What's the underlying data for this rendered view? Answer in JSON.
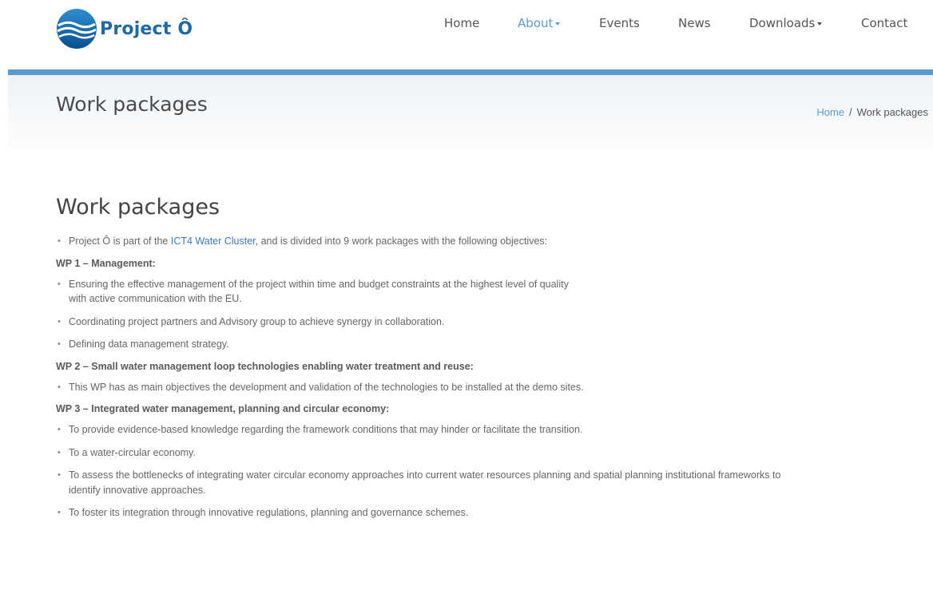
{
  "header": {
    "logo_text": "Project Ô",
    "nav": [
      {
        "label": "Home",
        "has_caret": false,
        "active": false
      },
      {
        "label": "About",
        "has_caret": true,
        "active": true
      },
      {
        "label": "Events",
        "has_caret": false,
        "active": false
      },
      {
        "label": "News",
        "has_caret": false,
        "active": false
      },
      {
        "label": "Downloads",
        "has_caret": true,
        "active": false
      },
      {
        "label": "Contact",
        "has_caret": false,
        "active": false
      }
    ]
  },
  "banner": {
    "title": "Work packages",
    "breadcrumb": {
      "home": "Home",
      "separator": "/",
      "current": "Work packages"
    }
  },
  "content": {
    "title": "Work packages",
    "intro": {
      "before": "Project Ô is part of the ",
      "link": "ICT4 Water Cluster",
      "after": ", and is divided into 9 work packages with the following objectives:"
    },
    "wp1": {
      "heading": "WP 1 – Management:",
      "items": [
        "Ensuring the effective management of the project within time and budget constraints at the highest level of quality",
        "with active communication with the EU.",
        "Coordinating project partners and Advisory group to achieve synergy in collaboration.",
        "Defining data management strategy."
      ]
    },
    "wp2": {
      "heading": "WP 2 – Small water management loop technologies enabling water treatment and reuse:",
      "items": [
        "This WP has as main objectives the development and validation of the technologies to be installed at the demo sites."
      ]
    },
    "wp3": {
      "heading": "WP 3 – Integrated water management, planning and circular economy:",
      "items": [
        "To provide evidence-based knowledge regarding the framework conditions that may hinder or facilitate the transition.",
        "To a water-circular economy.",
        "To assess the bottlenecks of integrating water circular economy approaches into current water resources planning and spatial planning institutional frameworks to",
        "identify innovative approaches.",
        "To foster its integration through innovative regulations, planning and governance schemes."
      ]
    }
  },
  "colors": {
    "accent": "#5b9bd5",
    "logo": "#1f6aa6",
    "link": "#3a7bbf"
  }
}
